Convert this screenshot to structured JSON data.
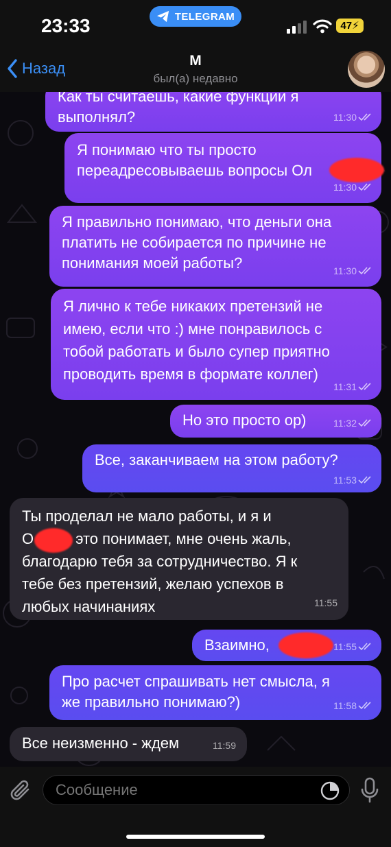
{
  "status_bar": {
    "time": "23:33",
    "app_pill": "TELEGRAM",
    "battery": "47"
  },
  "header": {
    "back_label": "Назад",
    "chat_name": "М",
    "chat_status": "был(а) недавно"
  },
  "messages": [
    {
      "direction": "out",
      "text": "Как ты считаешь, какие функции я\nвыполнял?",
      "time": "11:30",
      "read": true
    },
    {
      "direction": "out",
      "text": "Я понимаю что ты просто\nпереадресовываешь вопросы Ол",
      "time": "11:30",
      "read": true
    },
    {
      "direction": "out",
      "text": "Я правильно понимаю, что деньги она\nплатить не собирается по причине не\nпонимания моей работы?",
      "time": "11:30",
      "read": true
    },
    {
      "direction": "out",
      "text": "Я лично к тебе никаких претензий не\nимею, если что :) мне понравилось с\nтобой работать и было супер приятно\nпроводить время в формате коллег)",
      "time": "11:31",
      "read": true
    },
    {
      "direction": "out",
      "text": "Но это просто ор)",
      "time": "11:32",
      "read": true
    },
    {
      "direction": "out",
      "text": "Все, заканчиваем на этом работу?",
      "time": "11:53",
      "read": true
    },
    {
      "direction": "in",
      "text": "Ты проделал не мало работы, и я и\nО          это понимает, мне очень жаль,\nблагодарю тебя за сотрудничество. Я к\nтебе без претензий, желаю успехов в\nлюбых начинаниях",
      "time": "11:55"
    },
    {
      "direction": "out",
      "text": "Взаимно,",
      "time": "11:55",
      "read": true
    },
    {
      "direction": "out",
      "text": "Про расчет спрашивать нет смысла, я\nже правильно понимаю?)",
      "time": "11:58",
      "read": true
    },
    {
      "direction": "in",
      "text": "Все неизменно - ждем",
      "time": "11:59"
    }
  ],
  "composer": {
    "placeholder": "Сообщение"
  },
  "colors": {
    "accent": "#3b8ff6",
    "outgoing_bubble": "#8540f0",
    "outgoing_bubble_late": "#5f4af0",
    "incoming_bubble": "#2a2730",
    "redaction": "#ff2a2a"
  },
  "icons": [
    "telegram-icon",
    "signal-icon",
    "wifi-icon",
    "battery-icon",
    "back-chevron-icon",
    "read-check-icon",
    "attach-icon",
    "sticker-icon",
    "mic-icon"
  ]
}
